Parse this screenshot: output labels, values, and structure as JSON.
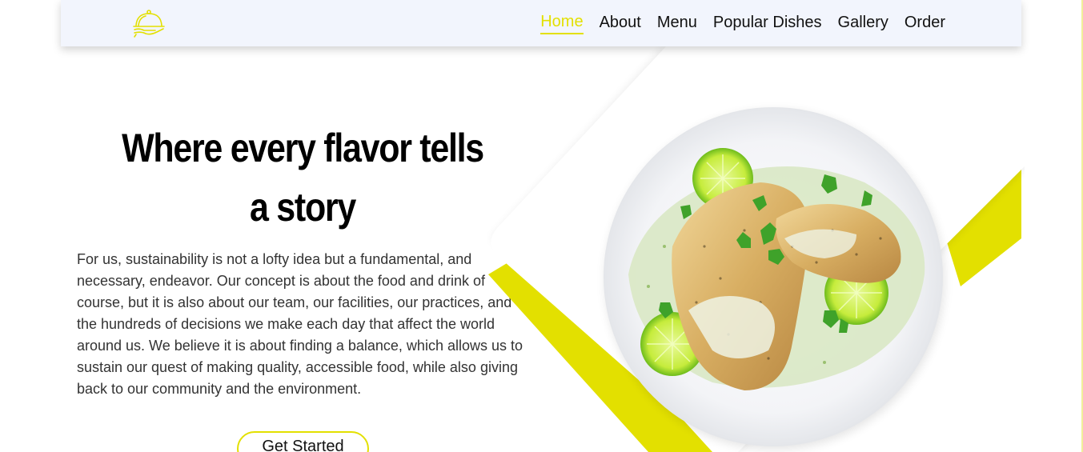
{
  "nav": {
    "logo_icon": "serving-cloche-icon",
    "items": [
      {
        "label": "Home",
        "active": true
      },
      {
        "label": "About",
        "active": false
      },
      {
        "label": "Menu",
        "active": false
      },
      {
        "label": "Popular Dishes",
        "active": false
      },
      {
        "label": "Gallery",
        "active": false
      },
      {
        "label": "Order",
        "active": false
      }
    ]
  },
  "hero": {
    "title": "Where every flavor tells a story",
    "text": "For us, sustainability is not a lofty idea but a fundamental, and necessary, endeavor. Our concept is about the food and drink of course, but it is also about our team, our facilities, our practices, and the hundreds of decisions we make each day that affect the world around us. We believe it is about finding a balance, which allows us to sustain our quest of making quality, accessible food, while also giving back to our community and the environment.",
    "cta_label": "Get Started",
    "image_subject": "grilled-fish-plate-with-lime"
  },
  "colors": {
    "accent": "#e3e000",
    "nav_bg": "#f2f5fd",
    "text": "#333333"
  }
}
